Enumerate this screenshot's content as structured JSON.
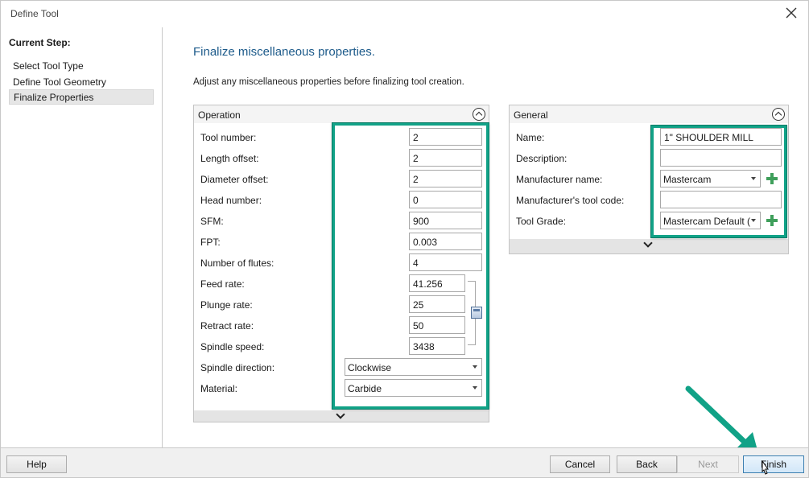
{
  "window": {
    "title": "Define Tool"
  },
  "sidebar": {
    "heading": "Current Step:",
    "steps": [
      {
        "label": "Select Tool Type"
      },
      {
        "label": "Define Tool Geometry"
      },
      {
        "label": "Finalize Properties"
      }
    ]
  },
  "main": {
    "heading": "Finalize miscellaneous properties.",
    "subheading": "Adjust any miscellaneous properties before finalizing tool creation."
  },
  "operation": {
    "title": "Operation",
    "fields": [
      {
        "label": "Tool number:",
        "value": "2"
      },
      {
        "label": "Length offset:",
        "value": "2"
      },
      {
        "label": "Diameter offset:",
        "value": "2"
      },
      {
        "label": "Head number:",
        "value": "0"
      },
      {
        "label": "SFM:",
        "value": "900"
      },
      {
        "label": "FPT:",
        "value": "0.003"
      },
      {
        "label": "Number of flutes:",
        "value": "4"
      },
      {
        "label": "Feed rate:",
        "value": "41.256"
      },
      {
        "label": "Plunge rate:",
        "value": "25"
      },
      {
        "label": "Retract rate:",
        "value": "50"
      },
      {
        "label": "Spindle speed:",
        "value": "3438"
      },
      {
        "label": "Spindle direction:",
        "value": "Clockwise"
      },
      {
        "label": "Material:",
        "value": "Carbide"
      }
    ]
  },
  "general": {
    "title": "General",
    "fields": [
      {
        "label": "Name:",
        "value": "1\" SHOULDER MILL"
      },
      {
        "label": "Description:",
        "value": ""
      },
      {
        "label": "Manufacturer name:",
        "value": "Mastercam"
      },
      {
        "label": "Manufacturer's tool code:",
        "value": ""
      },
      {
        "label": "Tool Grade:",
        "value": "Mastercam Default ("
      }
    ]
  },
  "footer": {
    "help": "Help",
    "cancel": "Cancel",
    "back": "Back",
    "next": "Next",
    "finish": "Finish"
  },
  "colors": {
    "highlight": "#11a287",
    "heading": "#1c5a8a",
    "add": "#3f9f5b"
  },
  "icons": [
    "close-icon",
    "collapse-up-icon",
    "expand-down-icon",
    "add-icon",
    "calculator-icon",
    "annotation-arrow",
    "mouse-cursor-icon"
  ]
}
